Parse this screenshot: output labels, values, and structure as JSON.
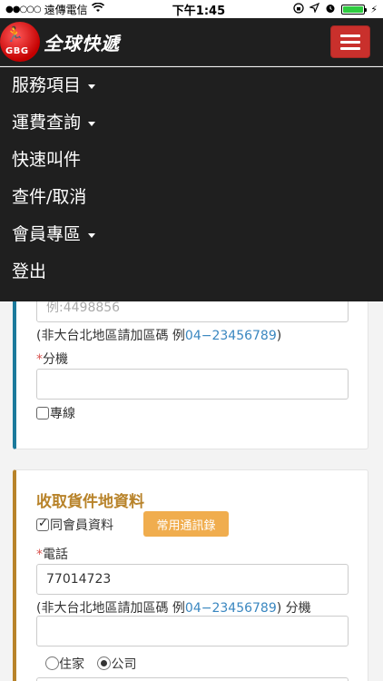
{
  "status_bar": {
    "carrier": "遠傳電信",
    "time": "下午1:45",
    "battery_color": "#2ecc40"
  },
  "header": {
    "logo_text": "GBG",
    "brand_name": "全球快遞"
  },
  "menu": {
    "items": [
      {
        "label": "服務項目",
        "has_caret": true
      },
      {
        "label": "運費查詢",
        "has_caret": true
      },
      {
        "label": "快速叫件",
        "has_caret": false
      },
      {
        "label": "查件/取消",
        "has_caret": false
      },
      {
        "label": "會員專區",
        "has_caret": true
      },
      {
        "label": "登出",
        "has_caret": false
      }
    ]
  },
  "sender_card": {
    "phone_placeholder": "例:4498856",
    "area_note_prefix": "(非大台北地區請加區碼 例",
    "area_note_example": "04−23456789",
    "area_note_suffix": ")",
    "extension_label": "分機",
    "extension_value": "",
    "dedicated_line_label": "專線",
    "dedicated_line_checked": false
  },
  "pickup_card": {
    "title": "收取貨件地資料",
    "same_as_member_label": "同會員資料",
    "same_as_member_checked": true,
    "address_book_button": "常用通訊錄",
    "phone_label": "電話",
    "phone_value": "77014723",
    "area_note_prefix": "(非大台北地區請加區碼 例",
    "area_note_example": "04−23456789",
    "area_note_suffix": ") 分機",
    "extension_value": "",
    "location_options": [
      {
        "label": "住家",
        "selected": false
      },
      {
        "label": "公司",
        "selected": true
      }
    ]
  }
}
